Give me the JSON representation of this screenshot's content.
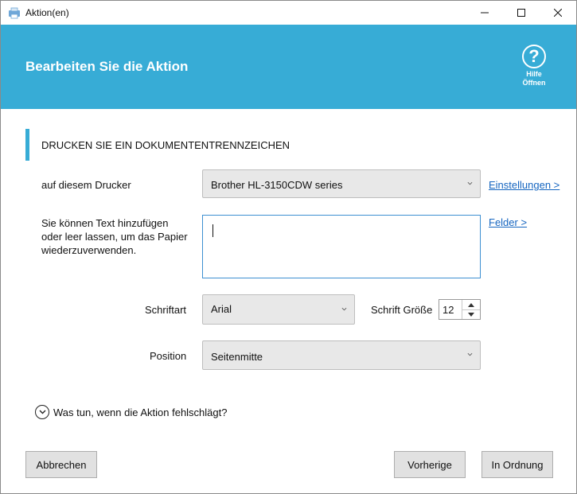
{
  "window": {
    "title": "Aktion(en)"
  },
  "header": {
    "title": "Bearbeiten Sie die Aktion",
    "help_label_line1": "Hilfe",
    "help_label_line2": "Öffnen",
    "help_symbol": "?"
  },
  "section": {
    "title": "DRUCKEN SIE EIN DOKUMENTENTRENNZEICHEN"
  },
  "printer": {
    "label": "auf diesem Drucker",
    "selected": "Brother HL-3150CDW series",
    "settings_link": "Einstellungen >"
  },
  "text": {
    "label_line1": "Sie können Text hinzufügen",
    "label_line2": "oder leer lassen, um das Papier",
    "label_line3": "wiederzuverwenden.",
    "value": "",
    "fields_link": "Felder >"
  },
  "font": {
    "label": "Schriftart",
    "selected": "Arial",
    "size_label": "Schrift Größe",
    "size_value": "12"
  },
  "position": {
    "label": "Position",
    "selected": "Seitenmitte"
  },
  "failure": {
    "label": "Was tun, wenn die Aktion fehlschlägt?"
  },
  "footer": {
    "cancel": "Abbrechen",
    "previous": "Vorherige",
    "ok": "In Ordnung"
  },
  "colors": {
    "header_bg": "#37acd6",
    "link": "#1565c0",
    "accent_bar": "#37acd6"
  }
}
